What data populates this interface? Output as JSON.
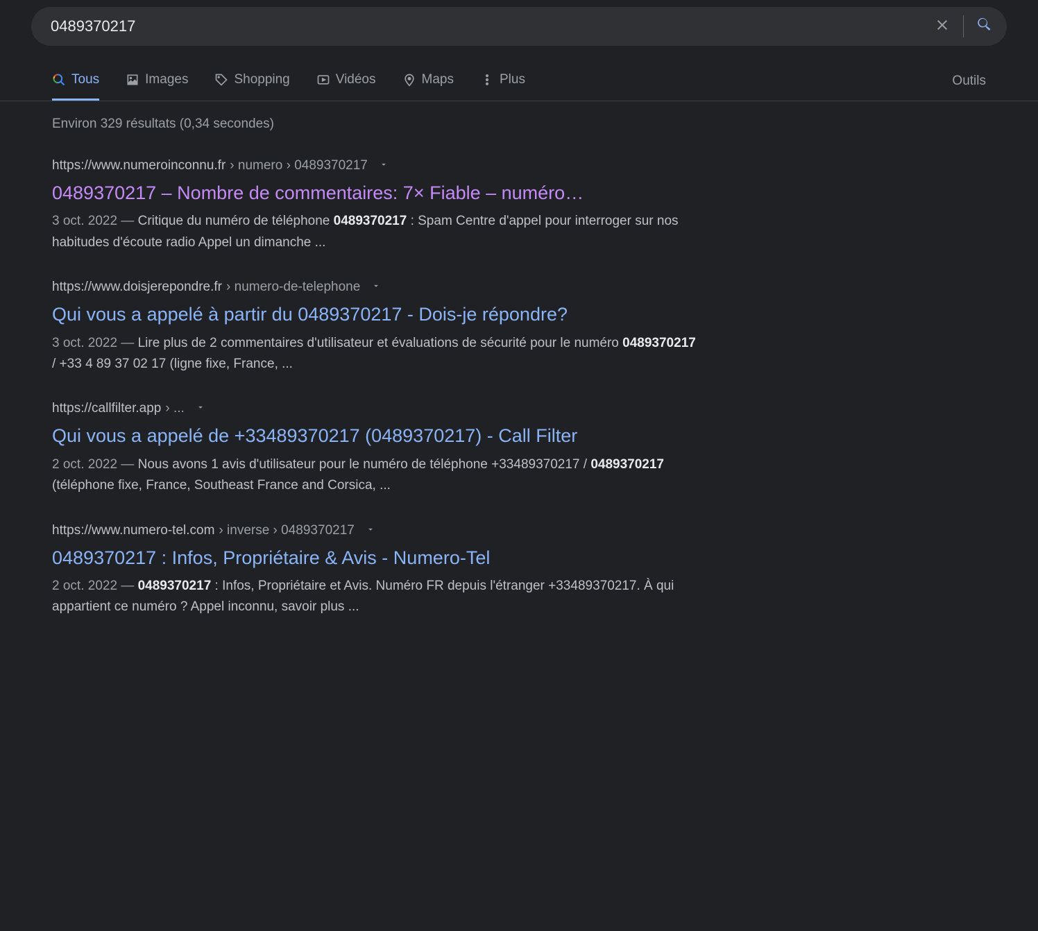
{
  "search": {
    "query": "0489370217"
  },
  "tabs": {
    "all": "Tous",
    "images": "Images",
    "shopping": "Shopping",
    "videos": "Vidéos",
    "maps": "Maps",
    "more": "Plus",
    "tools": "Outils"
  },
  "stats": "Environ 329 résultats (0,34 secondes)",
  "results": [
    {
      "domain": "https://www.numeroinconnu.fr",
      "path": " › numero › 0489370217",
      "title": "0489370217 – Nombre de commentaires: 7× Fiable – numéro…",
      "visited": true,
      "date": "3 oct. 2022",
      "snippet_pre": "Critique du numéro de téléphone ",
      "snippet_bold": "0489370217",
      "snippet_post": " : Spam Centre d'appel pour interroger sur nos habitudes d'écoute radio Appel un dimanche ..."
    },
    {
      "domain": "https://www.doisjerepondre.fr",
      "path": " › numero-de-telephone",
      "title": "Qui vous a appelé à partir du 0489370217 - Dois-je répondre?",
      "visited": false,
      "date": "3 oct. 2022",
      "snippet_pre": "Lire plus de 2 commentaires d'utilisateur et évaluations de sécurité pour le numéro ",
      "snippet_bold": "0489370217",
      "snippet_post": " / +33 4 89 37 02 17 (ligne fixe, France, ..."
    },
    {
      "domain": "https://callfilter.app",
      "path": " › ...",
      "title": "Qui vous a appelé de +33489370217 (0489370217) - Call Filter",
      "visited": false,
      "date": "2 oct. 2022",
      "snippet_pre": "Nous avons 1 avis d'utilisateur pour le numéro de téléphone +33489370217 / ",
      "snippet_bold": "0489370217",
      "snippet_post": " (téléphone fixe, France, Southeast France and Corsica, ..."
    },
    {
      "domain": "https://www.numero-tel.com",
      "path": " › inverse › 0489370217",
      "title": "0489370217 : Infos, Propriétaire & Avis - Numero-Tel",
      "visited": false,
      "date": "2 oct. 2022",
      "snippet_pre": "",
      "snippet_bold": "0489370217",
      "snippet_post": " : Infos, Propriétaire et Avis. Numéro FR depuis l'étranger +33489370217. À qui appartient ce numéro ? Appel inconnu, savoir plus ..."
    }
  ]
}
